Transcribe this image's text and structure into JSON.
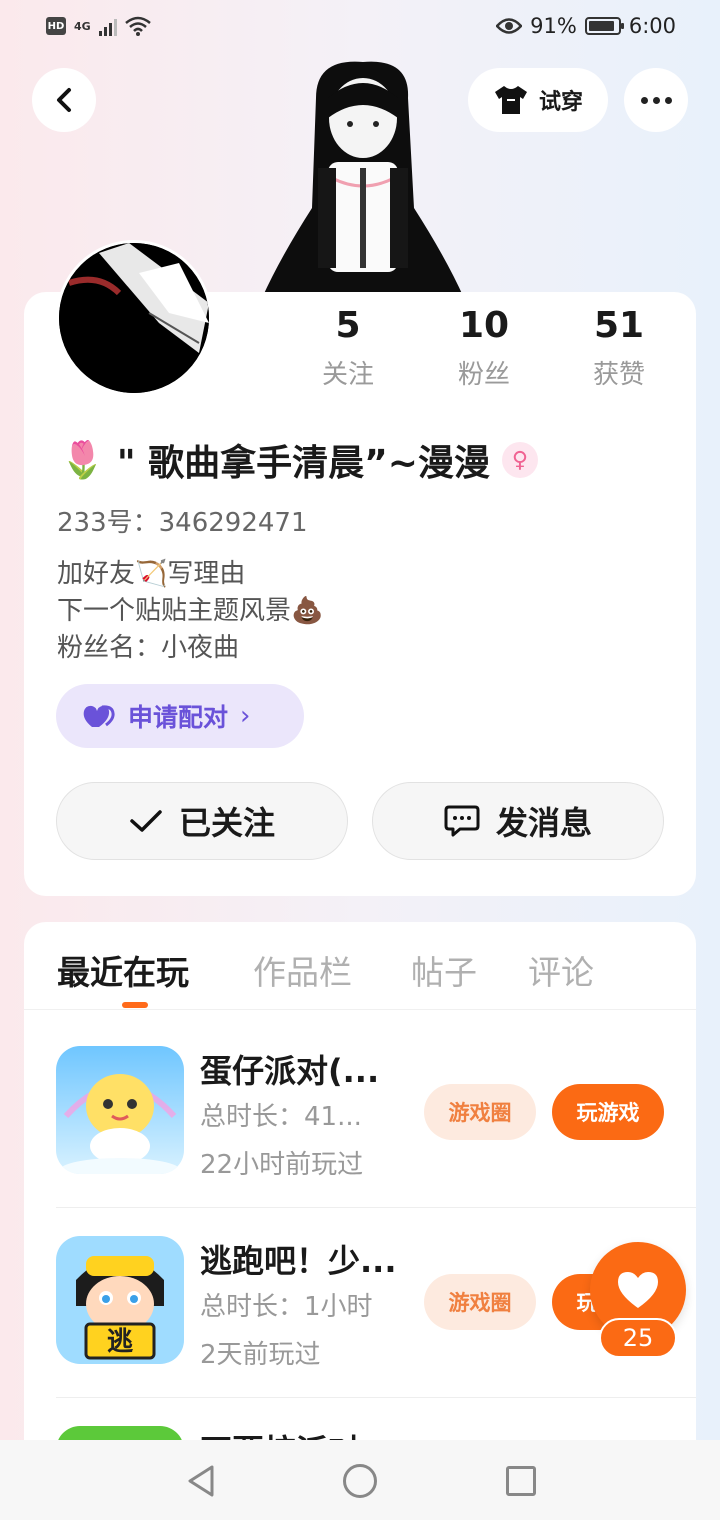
{
  "status_bar": {
    "hd": "HD",
    "network": "4G",
    "battery_text": "91%",
    "battery_level": 0.91,
    "time": "6:00"
  },
  "header": {
    "try_on_label": "试穿"
  },
  "profile": {
    "stats": [
      {
        "value": "5",
        "label": "关注"
      },
      {
        "value": "10",
        "label": "粉丝"
      },
      {
        "value": "51",
        "label": "获赞"
      }
    ],
    "name_emoji": "🌷",
    "name": "\" 歌曲拿手清晨”~漫漫",
    "gender_symbol": "♀",
    "uid": "233号：346292471",
    "bio_lines": [
      "加好友🏹写理由",
      "下一个贴贴主题风景💩",
      "粉丝名：小夜曲"
    ],
    "pair_label": "申请配对",
    "pair_chevron": "›",
    "follow_label": "已关注",
    "message_label": "发消息"
  },
  "tabs": [
    {
      "label": "最近在玩",
      "active": true
    },
    {
      "label": "作品栏",
      "active": false
    },
    {
      "label": "帖子",
      "active": false
    },
    {
      "label": "评论",
      "active": false
    }
  ],
  "games": [
    {
      "title": "蛋仔派对(...",
      "duration": "总时长：41...",
      "last_played": "22小时前玩过",
      "circle_label": "游戏圈",
      "play_label": "玩游戏"
    },
    {
      "title": "逃跑吧！少...",
      "duration": "总时长：1小时",
      "last_played": "2天前玩过",
      "circle_label": "游戏圈",
      "play_label": "玩游戏"
    },
    {
      "title": "不要按派对",
      "duration": "",
      "last_played": "",
      "circle_label": "",
      "play_label": ""
    }
  ],
  "like_fab": {
    "count": "25"
  },
  "colors": {
    "accent": "#fb6a14",
    "pair_purple": "#6a52d9",
    "pair_bg": "#ebe6fb"
  }
}
